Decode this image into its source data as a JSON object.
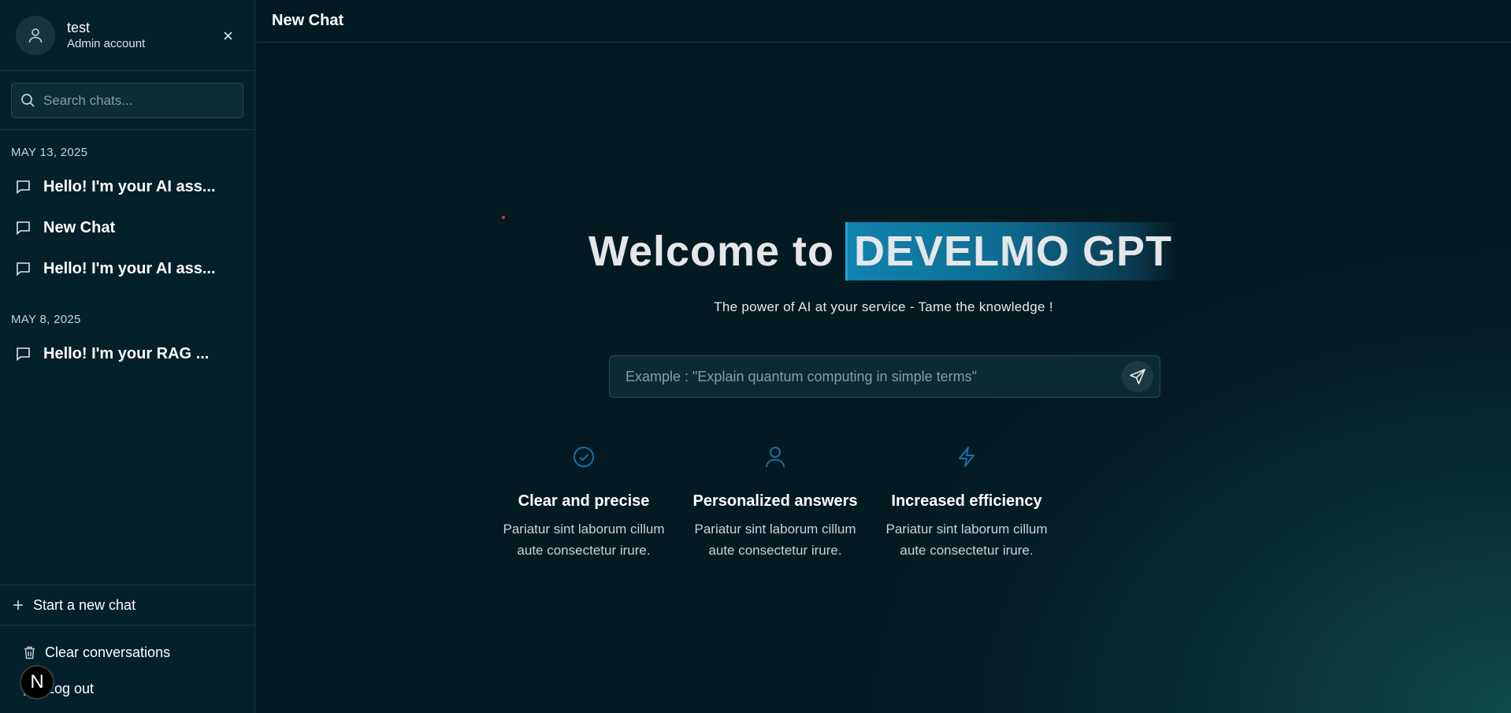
{
  "sidebar": {
    "profile": {
      "name": "test",
      "role": "Admin account"
    },
    "search": {
      "placeholder": "Search chats..."
    },
    "groups": [
      {
        "date": "MAY 13, 2025",
        "items": [
          "Hello! I'm your AI ass...",
          "New Chat",
          "Hello! I'm your AI ass..."
        ]
      },
      {
        "date": "MAY 8, 2025",
        "items": [
          "Hello! I'm your RAG ..."
        ]
      }
    ],
    "new_chat_label": "Start a new chat",
    "clear_label": "Clear conversations",
    "logout_label": "Log out",
    "badge_letter": "N"
  },
  "header": {
    "title": "New Chat"
  },
  "hero": {
    "welcome": "Welcome to",
    "brand": "DEVELMO GPT",
    "tagline": "The power of AI at your service - Tame the knowledge !"
  },
  "prompt": {
    "placeholder": "Example : \"Explain quantum computing in simple terms\""
  },
  "features": [
    {
      "icon": "check-circle-icon",
      "title": "Clear and precise",
      "desc_line1": "Pariatur sint laborum cillum",
      "desc_line2": "aute consectetur irure."
    },
    {
      "icon": "user-icon",
      "title": "Personalized answers",
      "desc_line1": "Pariatur sint laborum cillum",
      "desc_line2": "aute consectetur irure."
    },
    {
      "icon": "lightning-icon",
      "title": "Increased efficiency",
      "desc_line1": "Pariatur sint laborum cillum",
      "desc_line2": "aute consectetur irure."
    }
  ],
  "colors": {
    "accent": "#1084b0",
    "icon_blue": "#1a6fa8",
    "sidebar_bg": "#04202a",
    "main_bg": "#041a22"
  }
}
